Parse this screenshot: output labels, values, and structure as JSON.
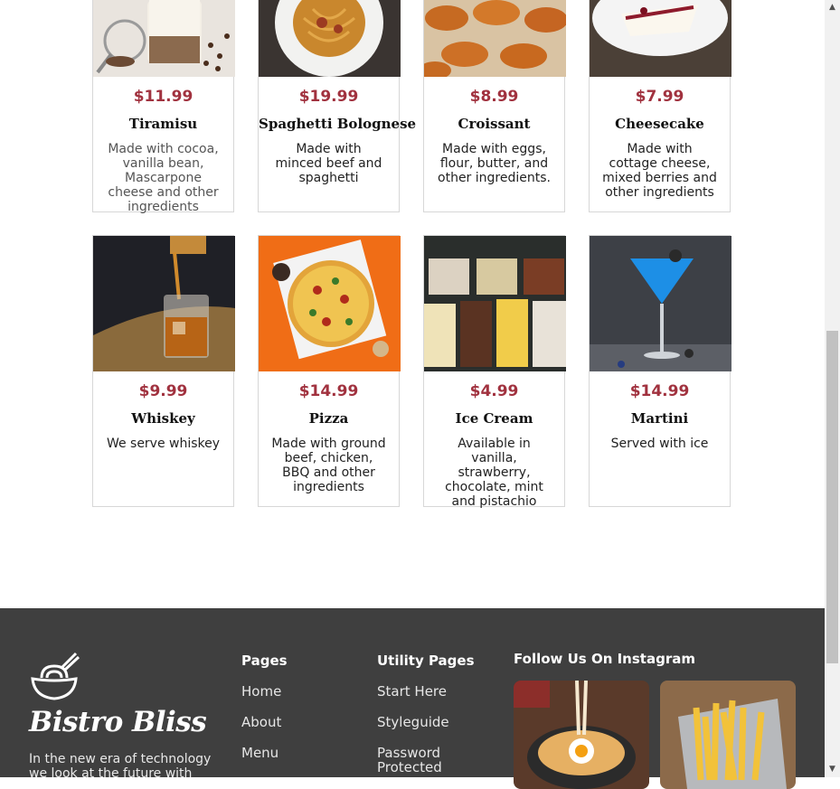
{
  "menu_items": [
    {
      "price": "$11.99",
      "name": "Tiramisu",
      "desc": "Made with cocoa, vanilla bean, Mascarpone cheese and other ingredients"
    },
    {
      "price": "$19.99",
      "name": "Spaghetti Bolognese",
      "desc": "Made with minced beef and spaghetti"
    },
    {
      "price": "$8.99",
      "name": "Croissant",
      "desc": "Made with eggs, flour, butter, and other ingredients."
    },
    {
      "price": "$7.99",
      "name": "Cheesecake",
      "desc": "Made with cottage cheese, mixed berries and other ingredients"
    },
    {
      "price": "$9.99",
      "name": "Whiskey",
      "desc": "We serve whiskey"
    },
    {
      "price": "$14.99",
      "name": "Pizza",
      "desc": "Made with ground beef, chicken, BBQ and other ingredients"
    },
    {
      "price": "$4.99",
      "name": "Ice Cream",
      "desc": "Available in vanilla, strawberry, chocolate, mint and pistachio"
    },
    {
      "price": "$14.99",
      "name": "Martini",
      "desc": "Served with ice"
    }
  ],
  "footer": {
    "brand": "Bistro Bliss",
    "logo_icon": "noodle-bowl-icon",
    "tagline": "In the new era of technology we look at the future with",
    "pages_title": "Pages",
    "pages_links": [
      "Home",
      "About",
      "Menu"
    ],
    "utility_title": "Utility Pages",
    "utility_links": [
      "Start Here",
      "Styleguide",
      "Password Protected"
    ],
    "instagram_title": "Follow Us On Instagram"
  },
  "colors": {
    "price": "#a1323f",
    "footer_bg": "#3f3f3f"
  }
}
